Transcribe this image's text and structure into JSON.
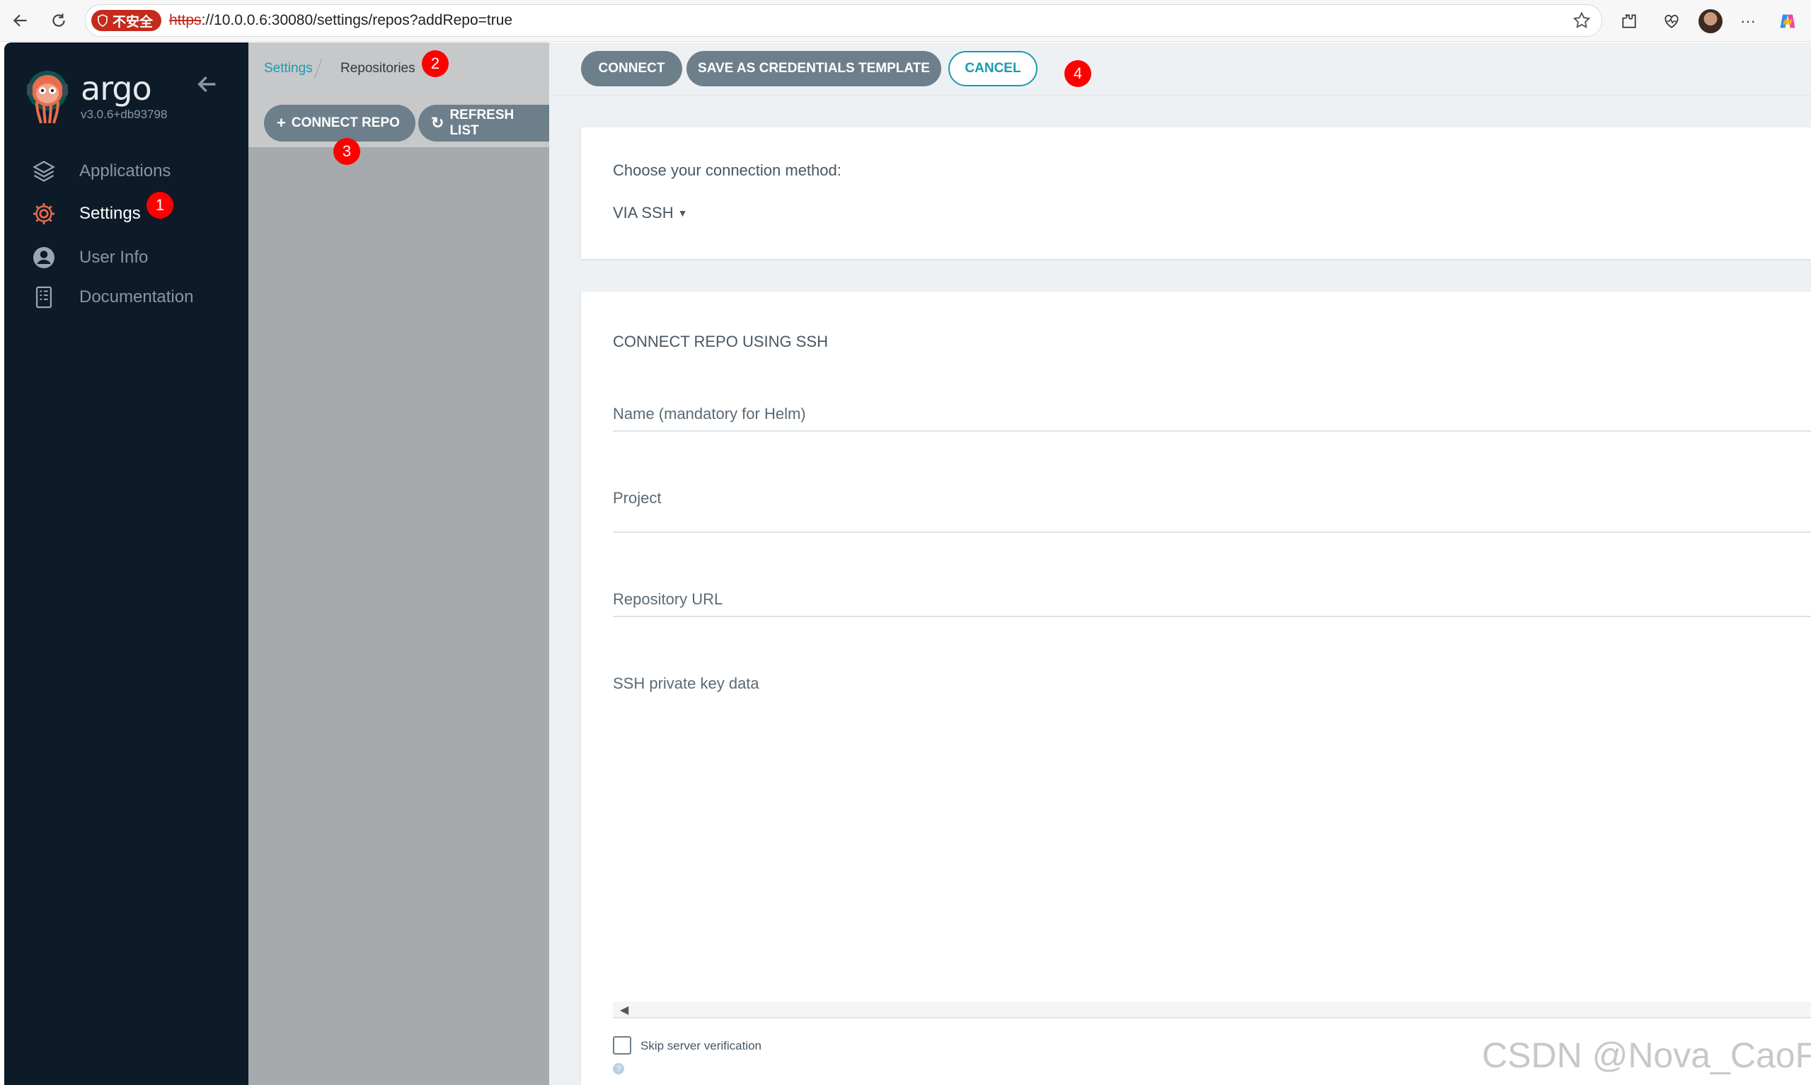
{
  "browser": {
    "security_label": "不安全",
    "url_scheme": "https",
    "url_rest": "://10.0.0.6:30080/settings/repos?addRepo=true",
    "icons": [
      "back-icon",
      "reload-icon",
      "star-icon",
      "extensions-icon",
      "performance-icon",
      "profile-avatar",
      "more-icon",
      "copilot-icon"
    ],
    "more_glyph": "···"
  },
  "sidebar": {
    "brand": "argo",
    "version": "v3.0.6+db93798",
    "items": [
      {
        "label": "Applications",
        "icon": "layers-icon"
      },
      {
        "label": "Settings",
        "icon": "gear-icon",
        "active": true
      },
      {
        "label": "User Info",
        "icon": "user-icon"
      },
      {
        "label": "Documentation",
        "icon": "book-icon"
      }
    ]
  },
  "repos_panel": {
    "breadcrumb": [
      "Settings",
      "Repositories"
    ],
    "buttons": {
      "connect_repo": "CONNECT REPO",
      "refresh_list": "REFRESH LIST"
    }
  },
  "main": {
    "actions": {
      "connect": "CONNECT",
      "save_template": "SAVE AS CREDENTIALS TEMPLATE",
      "cancel": "CANCEL"
    },
    "method_prompt": "Choose your connection method:",
    "method_value": "VIA SSH",
    "section_title": "CONNECT REPO USING SSH",
    "fields": {
      "name": "Name (mandatory for Helm)",
      "project": "Project",
      "repo_url": "Repository URL",
      "ssh_key": "SSH private key data"
    },
    "skip_verification": "Skip server verification",
    "help_glyph": "?"
  },
  "annotations": [
    "1",
    "2",
    "3",
    "4"
  ],
  "watermark": "CSDN @Nova_CaoFc",
  "colors": {
    "sidebar_bg": "#0d1b28",
    "repos_bg": "#a7aaad",
    "button_gray": "#6d7f8b",
    "accent_teal": "#1a9bb0",
    "marker_red": "#ff0000",
    "security_red": "#c42b1c"
  }
}
